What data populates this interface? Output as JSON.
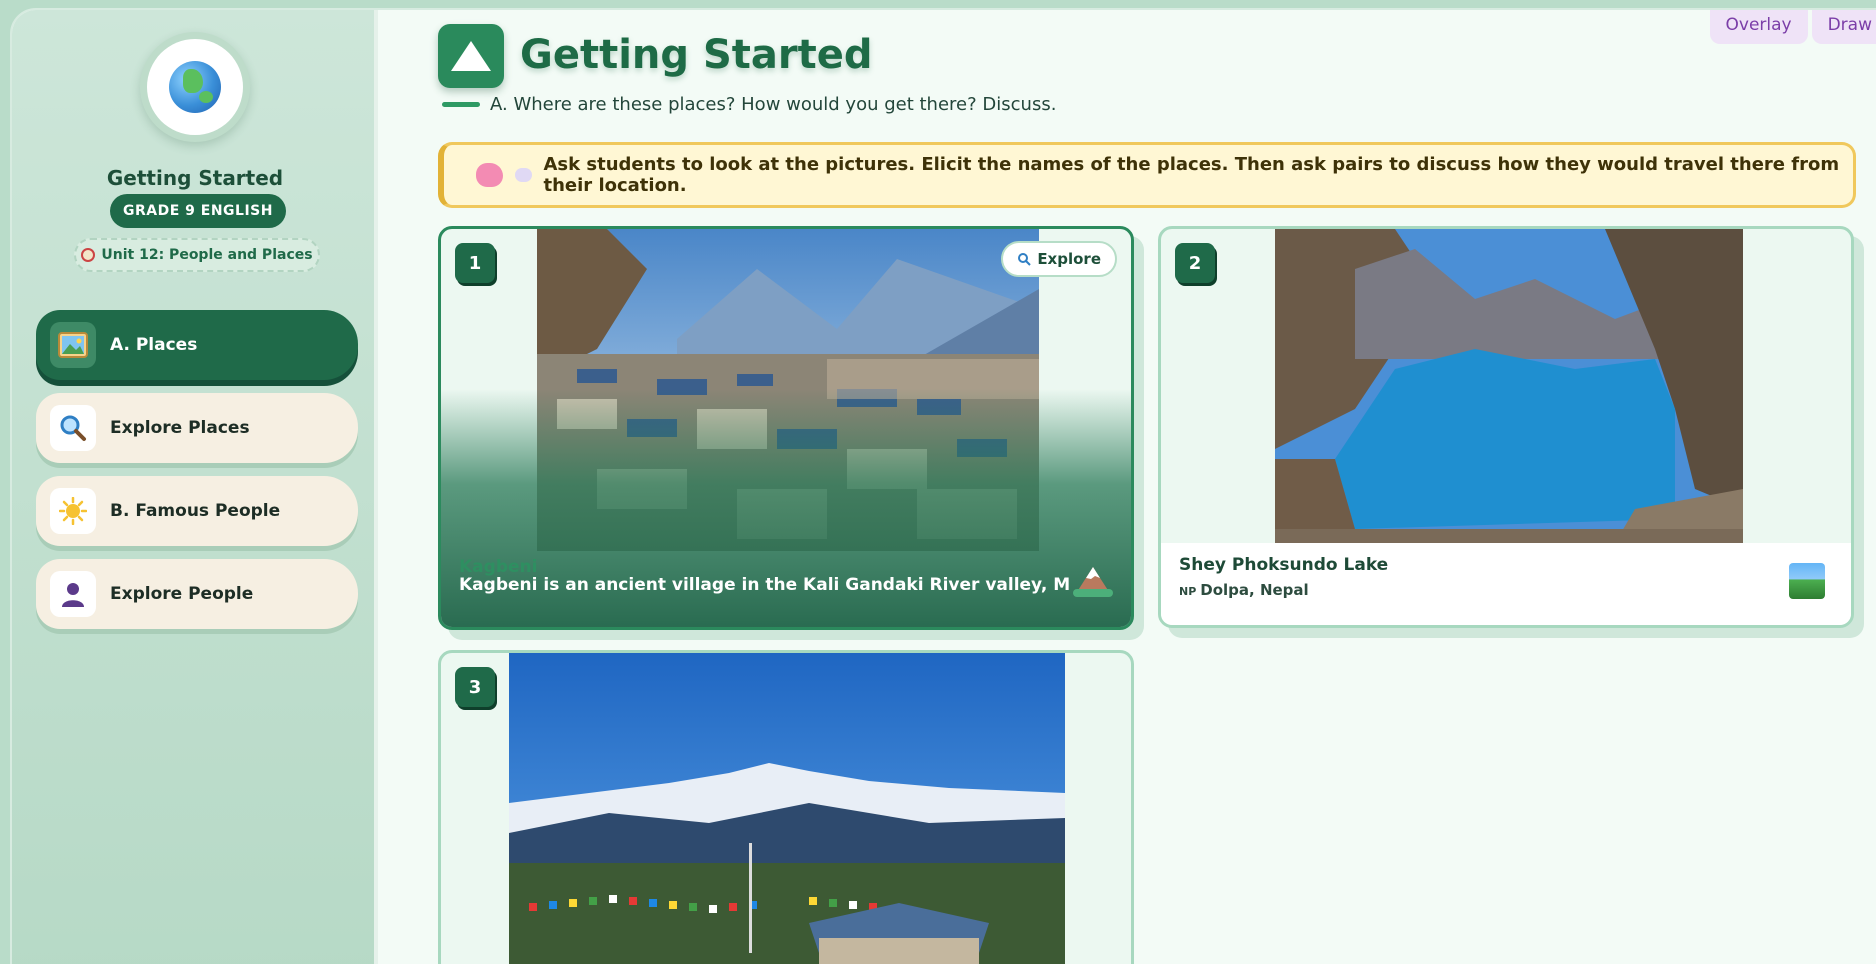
{
  "tools": {
    "overlay_label": "Overlay",
    "draw_label": "Draw"
  },
  "sidebar": {
    "title": "Getting Started",
    "grade": "GRADE 9 ENGLISH",
    "unit": "Unit 12: People and Places",
    "items": [
      {
        "label": "A. Places",
        "icon": "picture-icon",
        "active": true
      },
      {
        "label": "Explore Places",
        "icon": "magnifier-icon",
        "active": false
      },
      {
        "label": "B. Famous People",
        "icon": "sun-icon",
        "active": false
      },
      {
        "label": "Explore People",
        "icon": "person-icon",
        "active": false
      }
    ]
  },
  "main": {
    "title": "Getting Started",
    "subtitle": "A. Where are these places? How would you get there? Discuss.",
    "notice": "Ask students to look at the pictures. Elicit the names of the places. Then ask pairs to discuss how they would travel there from their location.",
    "cards": [
      {
        "number": "1",
        "name": "Kagbeni",
        "description": "Kagbeni is an ancient village in the Kali Gandaki River valley, Mustang dist",
        "explore_label": "Explore"
      },
      {
        "number": "2",
        "name": "Shey Phoksundo Lake",
        "flag": "NP",
        "location": "Dolpa, Nepal"
      },
      {
        "number": "3"
      }
    ]
  },
  "colors": {
    "accent": "#1f6a49",
    "title": "#1e6b46",
    "notice_bg": "#fff7d4",
    "notice_border": "#f0c85c",
    "tool_bg": "#efe3f7",
    "tool_text": "#7b3ea8"
  }
}
